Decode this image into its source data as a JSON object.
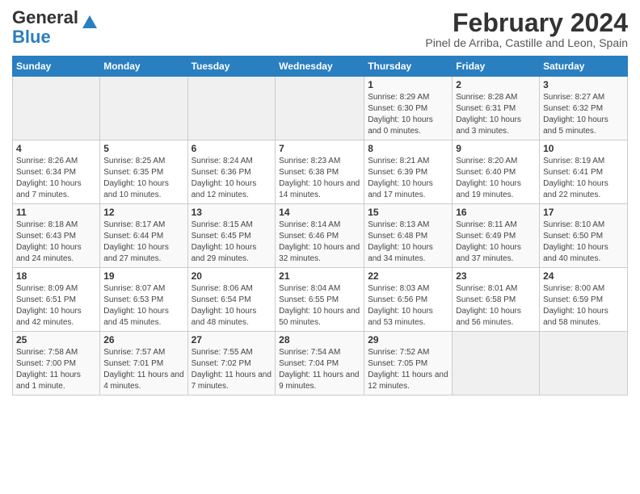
{
  "header": {
    "logo_general": "General",
    "logo_blue": "Blue",
    "month_title": "February 2024",
    "location": "Pinel de Arriba, Castille and Leon, Spain"
  },
  "calendar": {
    "days_of_week": [
      "Sunday",
      "Monday",
      "Tuesday",
      "Wednesday",
      "Thursday",
      "Friday",
      "Saturday"
    ],
    "weeks": [
      [
        {
          "day": "",
          "empty": true
        },
        {
          "day": "",
          "empty": true
        },
        {
          "day": "",
          "empty": true
        },
        {
          "day": "",
          "empty": true
        },
        {
          "day": "1",
          "sunrise": "8:29 AM",
          "sunset": "6:30 PM",
          "daylight": "10 hours and 0 minutes."
        },
        {
          "day": "2",
          "sunrise": "8:28 AM",
          "sunset": "6:31 PM",
          "daylight": "10 hours and 3 minutes."
        },
        {
          "day": "3",
          "sunrise": "8:27 AM",
          "sunset": "6:32 PM",
          "daylight": "10 hours and 5 minutes."
        }
      ],
      [
        {
          "day": "4",
          "sunrise": "8:26 AM",
          "sunset": "6:34 PM",
          "daylight": "10 hours and 7 minutes."
        },
        {
          "day": "5",
          "sunrise": "8:25 AM",
          "sunset": "6:35 PM",
          "daylight": "10 hours and 10 minutes."
        },
        {
          "day": "6",
          "sunrise": "8:24 AM",
          "sunset": "6:36 PM",
          "daylight": "10 hours and 12 minutes."
        },
        {
          "day": "7",
          "sunrise": "8:23 AM",
          "sunset": "6:38 PM",
          "daylight": "10 hours and 14 minutes."
        },
        {
          "day": "8",
          "sunrise": "8:21 AM",
          "sunset": "6:39 PM",
          "daylight": "10 hours and 17 minutes."
        },
        {
          "day": "9",
          "sunrise": "8:20 AM",
          "sunset": "6:40 PM",
          "daylight": "10 hours and 19 minutes."
        },
        {
          "day": "10",
          "sunrise": "8:19 AM",
          "sunset": "6:41 PM",
          "daylight": "10 hours and 22 minutes."
        }
      ],
      [
        {
          "day": "11",
          "sunrise": "8:18 AM",
          "sunset": "6:43 PM",
          "daylight": "10 hours and 24 minutes."
        },
        {
          "day": "12",
          "sunrise": "8:17 AM",
          "sunset": "6:44 PM",
          "daylight": "10 hours and 27 minutes."
        },
        {
          "day": "13",
          "sunrise": "8:15 AM",
          "sunset": "6:45 PM",
          "daylight": "10 hours and 29 minutes."
        },
        {
          "day": "14",
          "sunrise": "8:14 AM",
          "sunset": "6:46 PM",
          "daylight": "10 hours and 32 minutes."
        },
        {
          "day": "15",
          "sunrise": "8:13 AM",
          "sunset": "6:48 PM",
          "daylight": "10 hours and 34 minutes."
        },
        {
          "day": "16",
          "sunrise": "8:11 AM",
          "sunset": "6:49 PM",
          "daylight": "10 hours and 37 minutes."
        },
        {
          "day": "17",
          "sunrise": "8:10 AM",
          "sunset": "6:50 PM",
          "daylight": "10 hours and 40 minutes."
        }
      ],
      [
        {
          "day": "18",
          "sunrise": "8:09 AM",
          "sunset": "6:51 PM",
          "daylight": "10 hours and 42 minutes."
        },
        {
          "day": "19",
          "sunrise": "8:07 AM",
          "sunset": "6:53 PM",
          "daylight": "10 hours and 45 minutes."
        },
        {
          "day": "20",
          "sunrise": "8:06 AM",
          "sunset": "6:54 PM",
          "daylight": "10 hours and 48 minutes."
        },
        {
          "day": "21",
          "sunrise": "8:04 AM",
          "sunset": "6:55 PM",
          "daylight": "10 hours and 50 minutes."
        },
        {
          "day": "22",
          "sunrise": "8:03 AM",
          "sunset": "6:56 PM",
          "daylight": "10 hours and 53 minutes."
        },
        {
          "day": "23",
          "sunrise": "8:01 AM",
          "sunset": "6:58 PM",
          "daylight": "10 hours and 56 minutes."
        },
        {
          "day": "24",
          "sunrise": "8:00 AM",
          "sunset": "6:59 PM",
          "daylight": "10 hours and 58 minutes."
        }
      ],
      [
        {
          "day": "25",
          "sunrise": "7:58 AM",
          "sunset": "7:00 PM",
          "daylight": "11 hours and 1 minute."
        },
        {
          "day": "26",
          "sunrise": "7:57 AM",
          "sunset": "7:01 PM",
          "daylight": "11 hours and 4 minutes."
        },
        {
          "day": "27",
          "sunrise": "7:55 AM",
          "sunset": "7:02 PM",
          "daylight": "11 hours and 7 minutes."
        },
        {
          "day": "28",
          "sunrise": "7:54 AM",
          "sunset": "7:04 PM",
          "daylight": "11 hours and 9 minutes."
        },
        {
          "day": "29",
          "sunrise": "7:52 AM",
          "sunset": "7:05 PM",
          "daylight": "11 hours and 12 minutes."
        },
        {
          "day": "",
          "empty": true
        },
        {
          "day": "",
          "empty": true
        }
      ]
    ]
  }
}
